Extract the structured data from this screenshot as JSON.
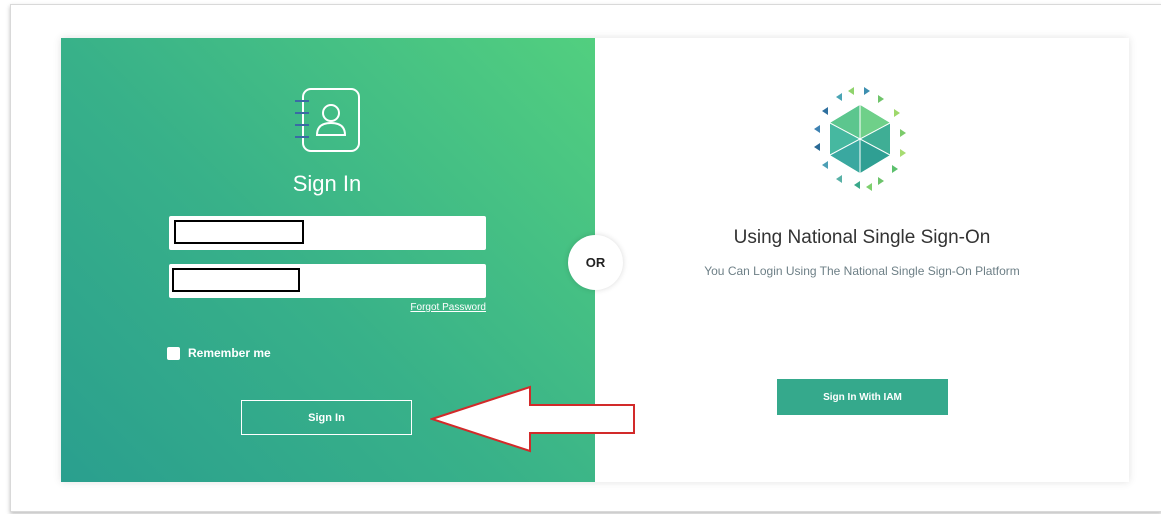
{
  "login": {
    "title": "Sign In",
    "username": {
      "value": "",
      "placeholder": ""
    },
    "password": {
      "value": "",
      "placeholder": ""
    },
    "forgot_password": "Forgot Password",
    "remember_me": "Remember me",
    "submit_label": "Sign In",
    "colors": {
      "gradient_start": "#2a9f8e",
      "gradient_end": "#52cf7f"
    }
  },
  "divider": {
    "label": "OR"
  },
  "sso": {
    "title": "Using National Single Sign-On",
    "subtitle": "You Can Login Using The National Single Sign-On Platform",
    "button_label": "Sign In With IAM",
    "button_color": "#35a98c"
  },
  "icons": {
    "contact": "contact-book-icon",
    "logo": "nsso-logo",
    "arrow": "red-arrow-annotation"
  }
}
